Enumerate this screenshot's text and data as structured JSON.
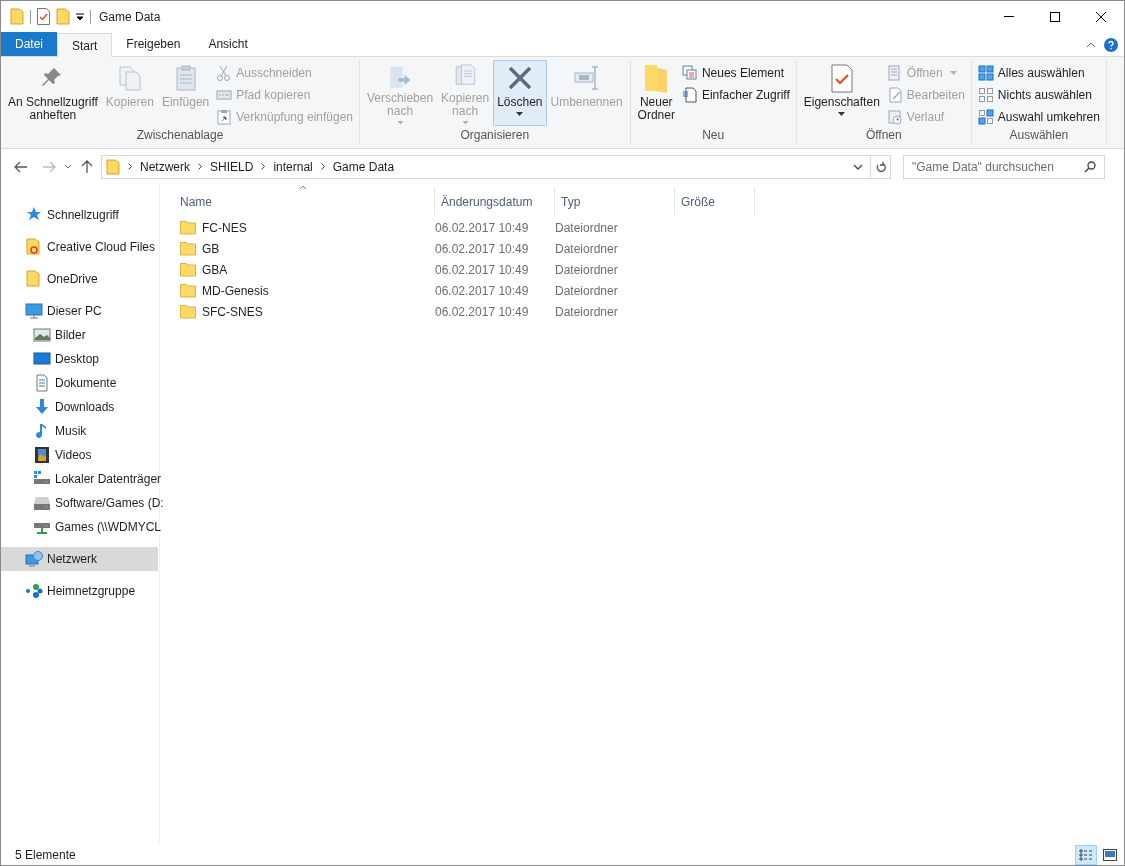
{
  "window": {
    "title": "Game Data"
  },
  "tabs": [
    {
      "label": "Datei",
      "kind": "file",
      "selected": false
    },
    {
      "label": "Start",
      "kind": "tab",
      "selected": true
    },
    {
      "label": "Freigeben",
      "kind": "tab",
      "selected": false
    },
    {
      "label": "Ansicht",
      "kind": "tab",
      "selected": false
    }
  ],
  "ribbon": {
    "groups": [
      {
        "label": "Zwischenablage",
        "items": [
          {
            "kind": "large",
            "label": "An Schnellzugriff\nanheften",
            "disabled": false,
            "selected": false,
            "dropdown": false
          },
          {
            "kind": "large",
            "label": "Kopieren",
            "disabled": true,
            "selected": false,
            "dropdown": false
          },
          {
            "kind": "large",
            "label": "Einfügen",
            "disabled": true,
            "selected": false,
            "dropdown": false
          },
          {
            "kind": "small",
            "label": "Ausschneiden",
            "disabled": true,
            "dropdown": false
          },
          {
            "kind": "small",
            "label": "Pfad kopieren",
            "disabled": true,
            "dropdown": false
          },
          {
            "kind": "small",
            "label": "Verknüpfung einfügen",
            "disabled": true,
            "dropdown": false
          }
        ]
      },
      {
        "label": "Organisieren",
        "items": [
          {
            "kind": "large",
            "label": "Verschieben\nnach",
            "disabled": true,
            "selected": false,
            "dropdown": true
          },
          {
            "kind": "large",
            "label": "Kopieren\nnach",
            "disabled": true,
            "selected": false,
            "dropdown": true
          },
          {
            "kind": "large",
            "label": "Löschen",
            "disabled": false,
            "selected": true,
            "dropdown": true
          },
          {
            "kind": "large",
            "label": "Umbenennen",
            "disabled": true,
            "selected": false,
            "dropdown": false
          }
        ]
      },
      {
        "label": "Neu",
        "items": [
          {
            "kind": "large",
            "label": "Neuer\nOrdner",
            "disabled": false,
            "selected": false,
            "dropdown": false
          },
          {
            "kind": "small",
            "label": "Neues Element",
            "disabled": false,
            "dropdown": false
          },
          {
            "kind": "small",
            "label": "Einfacher Zugriff",
            "disabled": false,
            "dropdown": false
          }
        ]
      },
      {
        "label": "Öffnen",
        "items": [
          {
            "kind": "large",
            "label": "Eigenschaften",
            "disabled": false,
            "selected": false,
            "dropdown": true
          },
          {
            "kind": "small",
            "label": "Öffnen",
            "disabled": true,
            "dropdown": true
          },
          {
            "kind": "small",
            "label": "Bearbeiten",
            "disabled": true,
            "dropdown": false
          },
          {
            "kind": "small",
            "label": "Verlauf",
            "disabled": true,
            "dropdown": false
          }
        ]
      },
      {
        "label": "Auswählen",
        "items": [
          {
            "kind": "small",
            "label": "Alles auswählen",
            "disabled": false,
            "dropdown": false
          },
          {
            "kind": "small",
            "label": "Nichts auswählen",
            "disabled": false,
            "dropdown": false
          },
          {
            "kind": "small",
            "label": "Auswahl umkehren",
            "disabled": false,
            "dropdown": false
          }
        ]
      }
    ]
  },
  "address": {
    "crumbs": [
      "Netzwerk",
      "SHIELD",
      "internal",
      "Game Data"
    ]
  },
  "search": {
    "placeholder": "\"Game Data\" durchsuchen"
  },
  "sidebar": {
    "items": [
      {
        "label": "Schnellzugriff",
        "selected": false
      },
      {
        "label": "Creative Cloud Files",
        "selected": false
      },
      {
        "label": "OneDrive",
        "selected": false
      },
      {
        "label": "Dieser PC",
        "selected": false,
        "children": [
          {
            "label": "Bilder",
            "selected": false
          },
          {
            "label": "Desktop",
            "selected": false
          },
          {
            "label": "Dokumente",
            "selected": false
          },
          {
            "label": "Downloads",
            "selected": false
          },
          {
            "label": "Musik",
            "selected": false
          },
          {
            "label": "Videos",
            "selected": false
          },
          {
            "label": "Lokaler Datenträger",
            "selected": false
          },
          {
            "label": "Software/Games (D:",
            "selected": false
          },
          {
            "label": "Games (\\\\WDMYCL",
            "selected": false
          }
        ]
      },
      {
        "label": "Netzwerk",
        "selected": true
      },
      {
        "label": "Heimnetzgruppe",
        "selected": false
      }
    ]
  },
  "table": {
    "columns": [
      "Name",
      "Änderungsdatum",
      "Typ",
      "Größe"
    ],
    "rows": [
      [
        "FC-NES",
        "06.02.2017 10:49",
        "Dateiordner"
      ],
      [
        "GB",
        "06.02.2017 10:49",
        "Dateiordner"
      ],
      [
        "GBA",
        "06.02.2017 10:49",
        "Dateiordner"
      ],
      [
        "MD-Genesis",
        "06.02.2017 10:49",
        "Dateiordner"
      ],
      [
        "SFC-SNES",
        "06.02.2017 10:49",
        "Dateiordner"
      ]
    ]
  },
  "status_bar": {
    "count": "5 Elemente",
    "views": [
      {
        "kind": "details",
        "selected": true
      },
      {
        "kind": "large-icons",
        "selected": false
      }
    ]
  }
}
